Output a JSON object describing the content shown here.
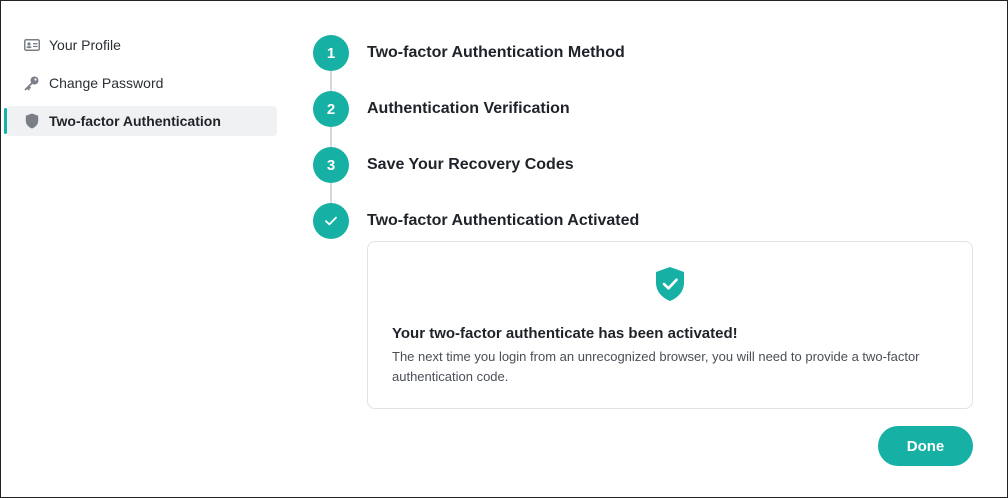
{
  "sidebar": {
    "items": [
      {
        "label": "Your Profile",
        "icon": "id-card-icon",
        "active": false
      },
      {
        "label": "Change Password",
        "icon": "key-icon",
        "active": false
      },
      {
        "label": "Two-factor Authentication",
        "icon": "shield-icon",
        "active": true
      }
    ]
  },
  "steps": [
    {
      "marker": "1",
      "title": "Two-factor Authentication Method"
    },
    {
      "marker": "2",
      "title": "Authentication Verification"
    },
    {
      "marker": "3",
      "title": "Save Your Recovery Codes"
    },
    {
      "marker": "check",
      "title": "Two-factor Authentication Activated"
    }
  ],
  "card": {
    "icon": "shield-check-icon",
    "heading": "Your two-factor authenticate has been activated!",
    "body": "The next time you login from an unrecognized browser, you will need to provide a two-factor authentication code."
  },
  "actions": {
    "done_label": "Done"
  },
  "colors": {
    "accent": "#16b0a4",
    "sidebar_active_bg": "#f0f1f3",
    "connector": "#d4d7dc"
  }
}
